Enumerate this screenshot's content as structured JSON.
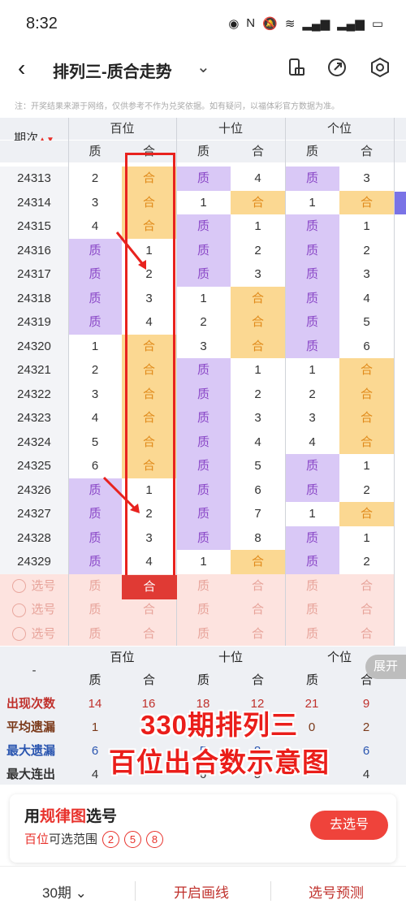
{
  "status": {
    "time": "8:32"
  },
  "nav": {
    "title": "排列三-质合走势",
    "chevron": "⌄"
  },
  "note": "注：开奖结果来源于网络，仅供参考不作为兑奖依据。如有疑问，以福体彩官方数据为准。",
  "table": {
    "issue_header": "期次",
    "groups": [
      "百位",
      "十位",
      "个位"
    ],
    "sub": [
      "质",
      "合",
      "质",
      "合",
      "质",
      "合"
    ],
    "rows": [
      {
        "issue": "24313",
        "cells": [
          "2",
          "合",
          "质",
          "4",
          "质",
          "3"
        ]
      },
      {
        "issue": "24314",
        "cells": [
          "3",
          "合",
          "1",
          "合",
          "1",
          "合"
        ]
      },
      {
        "issue": "24315",
        "cells": [
          "4",
          "合",
          "质",
          "1",
          "质",
          "1"
        ]
      },
      {
        "issue": "24316",
        "cells": [
          "质",
          "1",
          "质",
          "2",
          "质",
          "2"
        ]
      },
      {
        "issue": "24317",
        "cells": [
          "质",
          "2",
          "质",
          "3",
          "质",
          "3"
        ]
      },
      {
        "issue": "24318",
        "cells": [
          "质",
          "3",
          "1",
          "合",
          "质",
          "4"
        ]
      },
      {
        "issue": "24319",
        "cells": [
          "质",
          "4",
          "2",
          "合",
          "质",
          "5"
        ]
      },
      {
        "issue": "24320",
        "cells": [
          "1",
          "合",
          "3",
          "合",
          "质",
          "6"
        ]
      },
      {
        "issue": "24321",
        "cells": [
          "2",
          "合",
          "质",
          "1",
          "1",
          "合"
        ]
      },
      {
        "issue": "24322",
        "cells": [
          "3",
          "合",
          "质",
          "2",
          "2",
          "合"
        ]
      },
      {
        "issue": "24323",
        "cells": [
          "4",
          "合",
          "质",
          "3",
          "3",
          "合"
        ]
      },
      {
        "issue": "24324",
        "cells": [
          "5",
          "合",
          "质",
          "4",
          "4",
          "合"
        ]
      },
      {
        "issue": "24325",
        "cells": [
          "6",
          "合",
          "质",
          "5",
          "质",
          "1"
        ]
      },
      {
        "issue": "24326",
        "cells": [
          "质",
          "1",
          "质",
          "6",
          "质",
          "2"
        ]
      },
      {
        "issue": "24327",
        "cells": [
          "质",
          "2",
          "质",
          "7",
          "1",
          "合"
        ]
      },
      {
        "issue": "24328",
        "cells": [
          "质",
          "3",
          "质",
          "8",
          "质",
          "1"
        ]
      },
      {
        "issue": "24329",
        "cells": [
          "质",
          "4",
          "1",
          "合",
          "质",
          "2"
        ]
      }
    ],
    "select_label": "选号"
  },
  "stats": {
    "dash": "-",
    "rows": [
      {
        "label": "出现次数",
        "color": "#c0312c",
        "values": [
          "14",
          "16",
          "18",
          "12",
          "21",
          "9"
        ]
      },
      {
        "label": "平均遗漏",
        "color": "#7b3a1a",
        "values": [
          "1",
          "",
          "",
          "",
          "0",
          "2"
        ]
      },
      {
        "label": "最大遗漏",
        "color": "#2b56b0",
        "values": [
          "6",
          "",
          "5",
          "8",
          "",
          "6"
        ]
      },
      {
        "label": "最大连出",
        "color": "#333333",
        "values": [
          "4",
          "",
          "6",
          "5",
          "",
          "4"
        ]
      }
    ]
  },
  "expand": "展开",
  "overlay": {
    "line1": "330期排列三",
    "line2": "百位出合数示意图"
  },
  "card": {
    "t1": "用",
    "t2": "规律图",
    "t3": "选号",
    "sub1": "百位",
    "sub2": "可选范围",
    "balls": [
      "2",
      "5",
      "8"
    ],
    "button": "去选号"
  },
  "bottom": {
    "periods": "30期 ⌄",
    "draw": "开启画线",
    "predict": "选号预测"
  }
}
